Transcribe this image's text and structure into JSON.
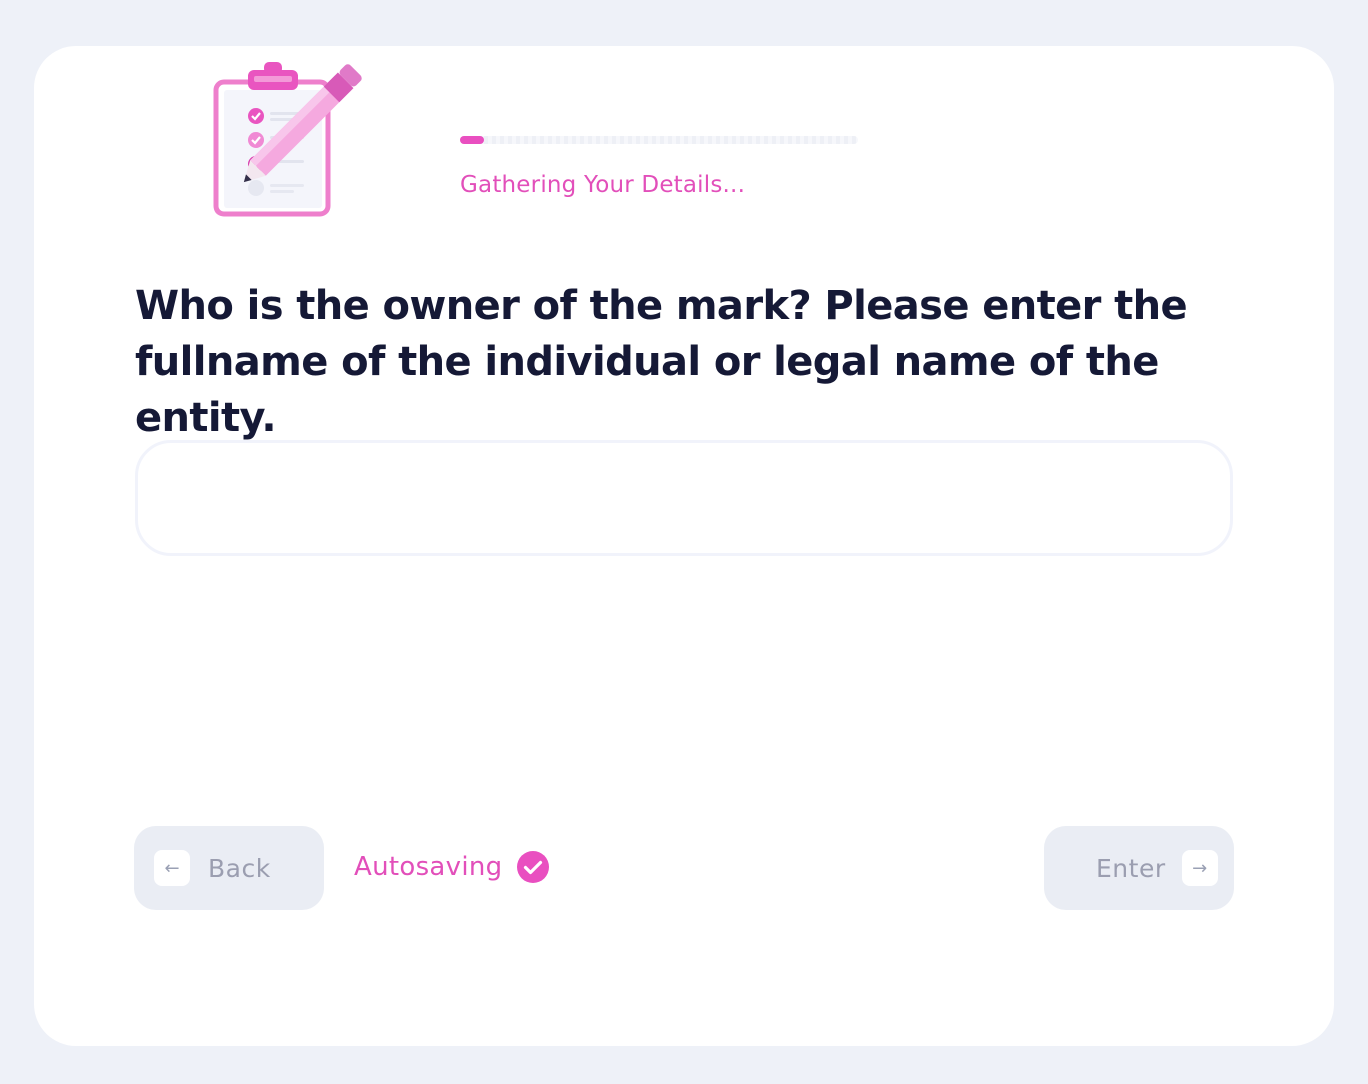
{
  "header": {
    "illustration_icon": "clipboard-checklist-pencil-icon",
    "progress": {
      "fraction": 0.06,
      "color": "#e94fc0"
    },
    "status_text": "Gathering Your Details..."
  },
  "question": {
    "text": "Who is the owner of the mark? Please enter the fullname of the individual or legal name of the entity."
  },
  "answer": {
    "value": "",
    "placeholder": ""
  },
  "footer": {
    "back_label": "Back",
    "back_icon": "arrow-left-icon",
    "autosave_label": "Autosaving",
    "autosave_icon": "check-circle-icon",
    "enter_label": "Enter",
    "enter_icon": "arrow-right-icon"
  },
  "colors": {
    "accent": "#e94fc0",
    "text_dark": "#151936",
    "background": "#eef1f8",
    "button_bg": "#eaedf4"
  }
}
